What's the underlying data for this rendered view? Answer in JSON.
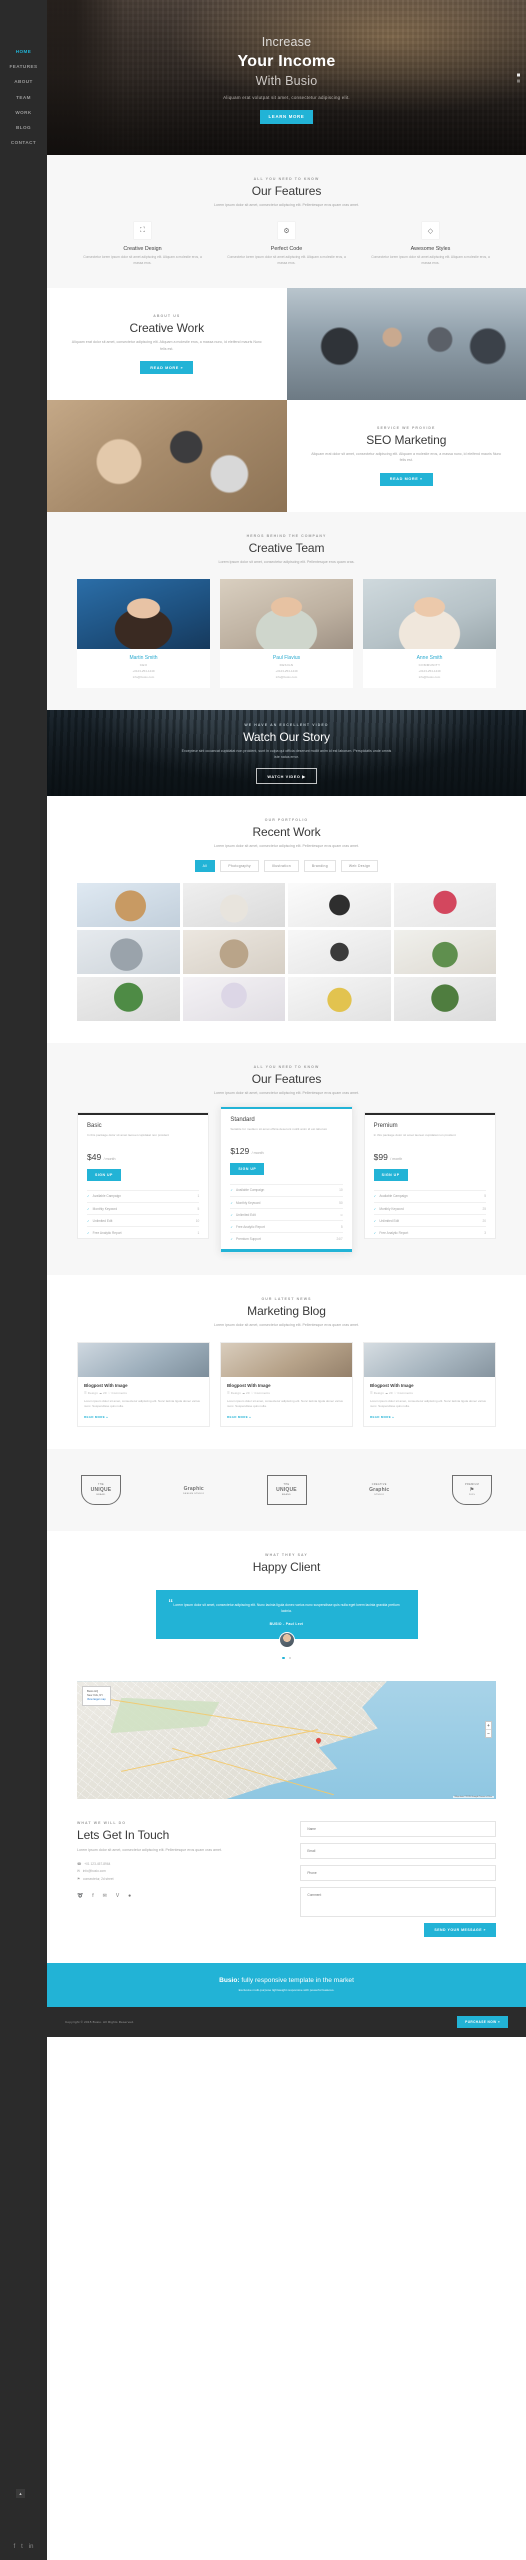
{
  "brand": {
    "name": "Busio",
    "accent": "#22b3d6",
    "dark": "#2b2b2b"
  },
  "sidebar": {
    "items": [
      {
        "label": "HOME",
        "active": true
      },
      {
        "label": "FEATURES",
        "active": false
      },
      {
        "label": "ABOUT",
        "active": false
      },
      {
        "label": "TEAM",
        "active": false
      },
      {
        "label": "WORK",
        "active": false
      },
      {
        "label": "BLOG",
        "active": false
      },
      {
        "label": "CONTACT",
        "active": false
      }
    ],
    "social": [
      "f",
      "t",
      "in"
    ]
  },
  "hero": {
    "line1": "Increase",
    "line2": "Your Income",
    "line3": "With Busio",
    "subtitle": "Aliquam erat volutpat sit amet, consectetur adipiscing elit.",
    "cta": "LEARN MORE"
  },
  "features": {
    "eyebrow": "ALL YOU NEED TO KNOW",
    "title": "Our Features",
    "lead": "Lorem ipsum dolor sit amet, consectetur adipiscing elit. Pellentesque eros quam cras amet.",
    "items": [
      {
        "icon": "image-icon",
        "glyph": "⛶",
        "title": "Creative Design",
        "text": "Consectetur lorem ipsum dolor sit amet adipiscing elit. Aliquam a molestie eros, a massa eros."
      },
      {
        "icon": "settings-icon",
        "glyph": "⚙",
        "title": "Perfect Code",
        "text": "Consectetur lorem ipsum dolor sit amet adipiscing elit. Aliquam a molestie eros, a massa eros."
      },
      {
        "icon": "diamond-icon",
        "glyph": "◇",
        "title": "Awesome Styles",
        "text": "Consectetur lorem ipsum dolor sit amet adipiscing elit. Aliquam a molestie eros, a massa eros."
      }
    ]
  },
  "about": {
    "eyebrow": "ABOUT US",
    "title": "Creative Work",
    "lead": "Aliquam erat dolor sit amet, consectetur adipiscing elit. Aliquam a molestie eros, a massa nunc, id eleifend mauris Nunc felis est.",
    "cta": "READ MORE »",
    "image": "team-meeting-photo"
  },
  "seo": {
    "eyebrow": "SERVICE WE PROVIDE",
    "title": "SEO Marketing",
    "lead": "Aliquam erat dolor sit amet, consectetur adipiscing elit. Aliquam a molestie eros, a massa nunc, id eleifend mauris Nunc felis est.",
    "cta": "READ MORE »",
    "image": "desk-hands-photo"
  },
  "team": {
    "eyebrow": "HEROS BEHIND THE COMPANY",
    "title": "Creative Team",
    "lead": "Lorem ipsum dolor sit amet, consectetur adipiscing elit. Pellentesque eros quam cras.",
    "members": [
      {
        "photo": "woman-blue-jacket",
        "name": "Martin Smith",
        "role": "CEO",
        "phone": "+0123-254-1449",
        "email": "info@busio.com"
      },
      {
        "photo": "woman-patterned-top",
        "name": "Paul Flavius",
        "role": "DESIGN",
        "phone": "+0123-254-1449",
        "email": "info@busio.com"
      },
      {
        "photo": "woman-white-shirt",
        "name": "Anne Smith",
        "role": "COMMUNITY",
        "phone": "+0123-254-1449",
        "email": "info@busio.com"
      }
    ]
  },
  "video": {
    "eyebrow": "WE HAVE AN EXCELLENT VIDEO",
    "title": "Watch Our Story",
    "lead": "Excepteur sint occaecat cupidatat non proident, sunt in culpa qui officia deserunt mollit anim id est laborum. Perspiciatis unde omnis iste natus error.",
    "cta": "WATCH VIDEO ▶"
  },
  "portfolio": {
    "eyebrow": "OUR PORTFOLIO",
    "title": "Recent Work",
    "lead": "Lorem ipsum dolor sit amet, consectetur adipiscing elit. Pellentesque eros quam cras amet.",
    "filters": [
      {
        "label": "All",
        "active": true
      },
      {
        "label": "Photography",
        "active": false
      },
      {
        "label": "Illustration",
        "active": false
      },
      {
        "label": "Branding",
        "active": false
      },
      {
        "label": "Web Design",
        "active": false
      }
    ],
    "items": [
      "pinecone-photo",
      "white-chair-photo",
      "black-box-branding",
      "red-flower-vase",
      "grey-car-photo",
      "office-interior-photo",
      "logo-mockup-photo",
      "potted-plant-photo",
      "green-plant-pot",
      "white-flowers-vase",
      "fruit-bowl-photo",
      "succulent-pot"
    ]
  },
  "pricing": {
    "eyebrow": "ALL YOU NEED TO KNOW",
    "title": "Our Features",
    "lead": "Lorem ipsum dolor sit amet, consectetur adipiscing elit. Pellentesque eros quam cras amet.",
    "plans": [
      {
        "name": "Basic",
        "desc": "In this package dolor sit amet laoreet cupidatat non proident",
        "price": "$49",
        "period": "/ month",
        "cta": "SIGN UP",
        "popular": false,
        "features": [
          {
            "label": "Available Campaign",
            "value": "1"
          },
          {
            "label": "Monthly Keyword",
            "value": "5"
          },
          {
            "label": "Unlimited Edit",
            "value": "10"
          },
          {
            "label": "Free Analytic Report",
            "value": "1"
          }
        ]
      },
      {
        "name": "Standard",
        "desc": "Suitable for medium sit amet officia deserunt mollit anim id est laborum",
        "price": "$129",
        "period": "/ month",
        "cta": "SIGN UP",
        "popular": true,
        "features": [
          {
            "label": "Available Campaign",
            "value": "10"
          },
          {
            "label": "Monthly Keyword",
            "value": "50"
          },
          {
            "label": "Unlimited Edit",
            "value": "∞"
          },
          {
            "label": "Free Analytic Report",
            "value": "5"
          },
          {
            "label": "Premium Support",
            "value": "24/7"
          }
        ]
      },
      {
        "name": "Premium",
        "desc": "In this package dolor sit amet laoreet cupidatat non proident",
        "price": "$99",
        "period": "/ month",
        "cta": "SIGN UP",
        "popular": false,
        "features": [
          {
            "label": "Available Campaign",
            "value": "5"
          },
          {
            "label": "Monthly Keyword",
            "value": "25"
          },
          {
            "label": "Unlimited Edit",
            "value": "20"
          },
          {
            "label": "Free Analytic Report",
            "value": "3"
          }
        ]
      }
    ]
  },
  "blog": {
    "eyebrow": "OUR LATEST NEWS",
    "title": "Marketing Blog",
    "lead": "Lorem ipsum dolor sit amet, consectetur adipiscing elit. Pellentesque eros quam cras amet.",
    "posts": [
      {
        "image": "meeting-table-photo",
        "title": "Blogpost With Image",
        "meta": "☰ Design   ☁ 20   ♡ Comments",
        "text": "Lorem ipsum dolor sit amet, consectetur adipiscing elit. Nunc lacinia ligula donec varius nunc. Suspendisse quis nulla.",
        "more": "READ MORE »"
      },
      {
        "image": "coffee-desk-photo",
        "title": "Blogpost With Image",
        "meta": "☰ Design   ☁ 20   ♡ Comments",
        "text": "Lorem ipsum dolor sit amet, consectetur adipiscing elit. Nunc lacinia ligula donec varius nunc. Suspendisse quis nulla.",
        "more": "READ MORE »"
      },
      {
        "image": "laptop-work-photo",
        "title": "Blogpost With Image",
        "meta": "☰ Design   ☁ 20   ♡ Comments",
        "text": "Lorem ipsum dolor sit amet, consectetur adipiscing elit. Nunc lacinia ligula donec varius nunc. Suspendisse quis nulla.",
        "more": "READ MORE »"
      }
    ]
  },
  "clients": {
    "logos": [
      {
        "top": "THE",
        "main": "UNIQUE",
        "sub": "BRAND",
        "style": "shield"
      },
      {
        "top": "",
        "main": "Graphic",
        "sub": "DESIGN STUDIO",
        "style": "plain"
      },
      {
        "top": "THE",
        "main": "UNIQUE",
        "sub": "BRAND",
        "style": "outline"
      },
      {
        "top": "CREATIVE",
        "main": "Graphic",
        "sub": "STUDIO",
        "style": "plain"
      },
      {
        "top": "PREMIUM",
        "main": "⚑",
        "sub": "2015",
        "style": "shield"
      }
    ]
  },
  "testimonial": {
    "eyebrow": "WHAT THEY SAY",
    "title": "Happy Client",
    "quote": "Lorem ipsum dolor sit amet, consectetur adipiscing elit. Nunc lacinia ligula donec varius nunc suspendisse quis nulla eget lorem lacinia gravida pretium lacinia.",
    "author": "BUSIO - Paul Levi",
    "avatar": "client-avatar"
  },
  "map": {
    "card_title": "Busio HQ",
    "card_line": "New York, NY",
    "card_link": "View larger map",
    "zoom_in": "+",
    "zoom_out": "−",
    "attribution": "Map data ©2015 Google  Terms of Use"
  },
  "contact": {
    "eyebrow": "WHAT WE WILL DO",
    "title": "Lets Get In Touch",
    "lead": "Lorem ipsum dolor sit amet, consectetur adipiscing elit. Pellentesque eros quam cras amet.",
    "details": [
      {
        "icon": "phone-icon",
        "glyph": "☎",
        "text": "+01 123-457-8964"
      },
      {
        "icon": "mail-icon",
        "glyph": "✉",
        "text": "info@busio.com"
      },
      {
        "icon": "location-icon",
        "glyph": "⚑",
        "text": "consectetur, 2d street"
      }
    ],
    "social": [
      {
        "name": "rss-icon",
        "glyph": "➰"
      },
      {
        "name": "facebook-icon",
        "glyph": "f"
      },
      {
        "name": "twitter-icon",
        "glyph": "✉"
      },
      {
        "name": "vimeo-icon",
        "glyph": "V"
      },
      {
        "name": "dribbble-icon",
        "glyph": "●"
      }
    ],
    "form": {
      "name_placeholder": "Name",
      "name_value": "",
      "email_placeholder": "Email",
      "email_value": "",
      "phone_placeholder": "Phone",
      "phone_value": "",
      "comment_placeholder": "Comment",
      "comment_value": "",
      "submit": "SEND YOUR MESSAGE »"
    }
  },
  "footer": {
    "cta_brand": "Busio:",
    "cta_title": " fully responsive template in the market",
    "cta_sub": "Exclusive multi-purpose lightweight responsive with powerful features.",
    "copyright": "Copyright © 2015 Busio. All Rights Reserved.",
    "purchase": "PURCHASE NOW »",
    "to_top": "▲"
  }
}
